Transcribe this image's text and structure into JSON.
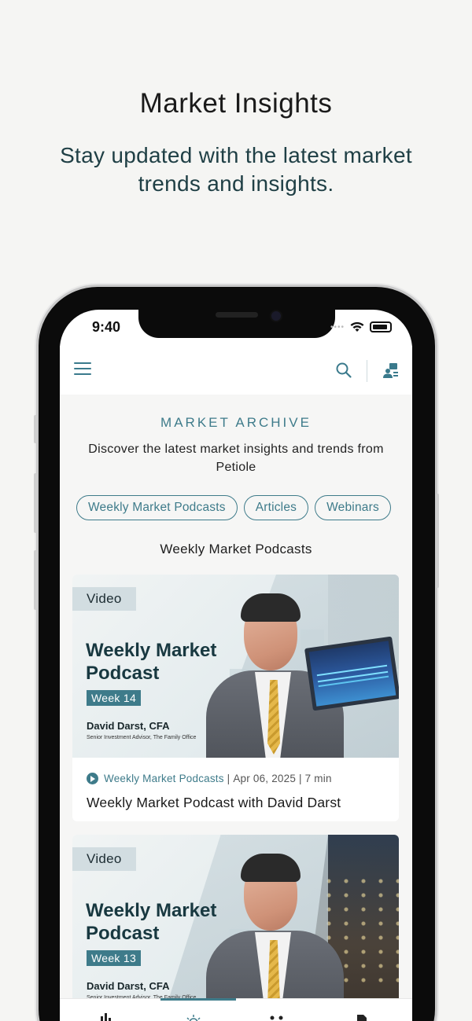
{
  "promo": {
    "headline": "Market Insights",
    "subhead": "Stay updated with the latest market trends and insights."
  },
  "status_bar": {
    "time": "9:40"
  },
  "header": {
    "icons": [
      "menu-icon",
      "search-icon",
      "user-account-icon"
    ]
  },
  "archive": {
    "title": "MARKET ARCHIVE",
    "description": "Discover the latest market insights and trends from Petiole",
    "chips": [
      "Weekly Market Podcasts",
      "Articles",
      "Webinars"
    ],
    "list_heading": "Weekly Market Podcasts"
  },
  "cards": [
    {
      "tag": "Video",
      "thumb_title": "Weekly Market Podcast",
      "week": "Week 14",
      "presenter": "David Darst, CFA",
      "presenter_role": "Senior Investment Advisor, The Family Office",
      "category": "Weekly Market Podcasts",
      "date": "Apr 06, 2025",
      "duration": "7 min",
      "title": "Weekly Market Podcast with David Darst"
    },
    {
      "tag": "Video",
      "thumb_title": "Weekly Market Podcast",
      "week": "Week 13",
      "presenter": "David Darst, CFA",
      "presenter_role": "Senior Investment Advisor, The Family Office"
    }
  ],
  "colors": {
    "accent": "#3e7b8a",
    "background": "#f5f5f3",
    "text_dark": "#1a1a1a"
  }
}
